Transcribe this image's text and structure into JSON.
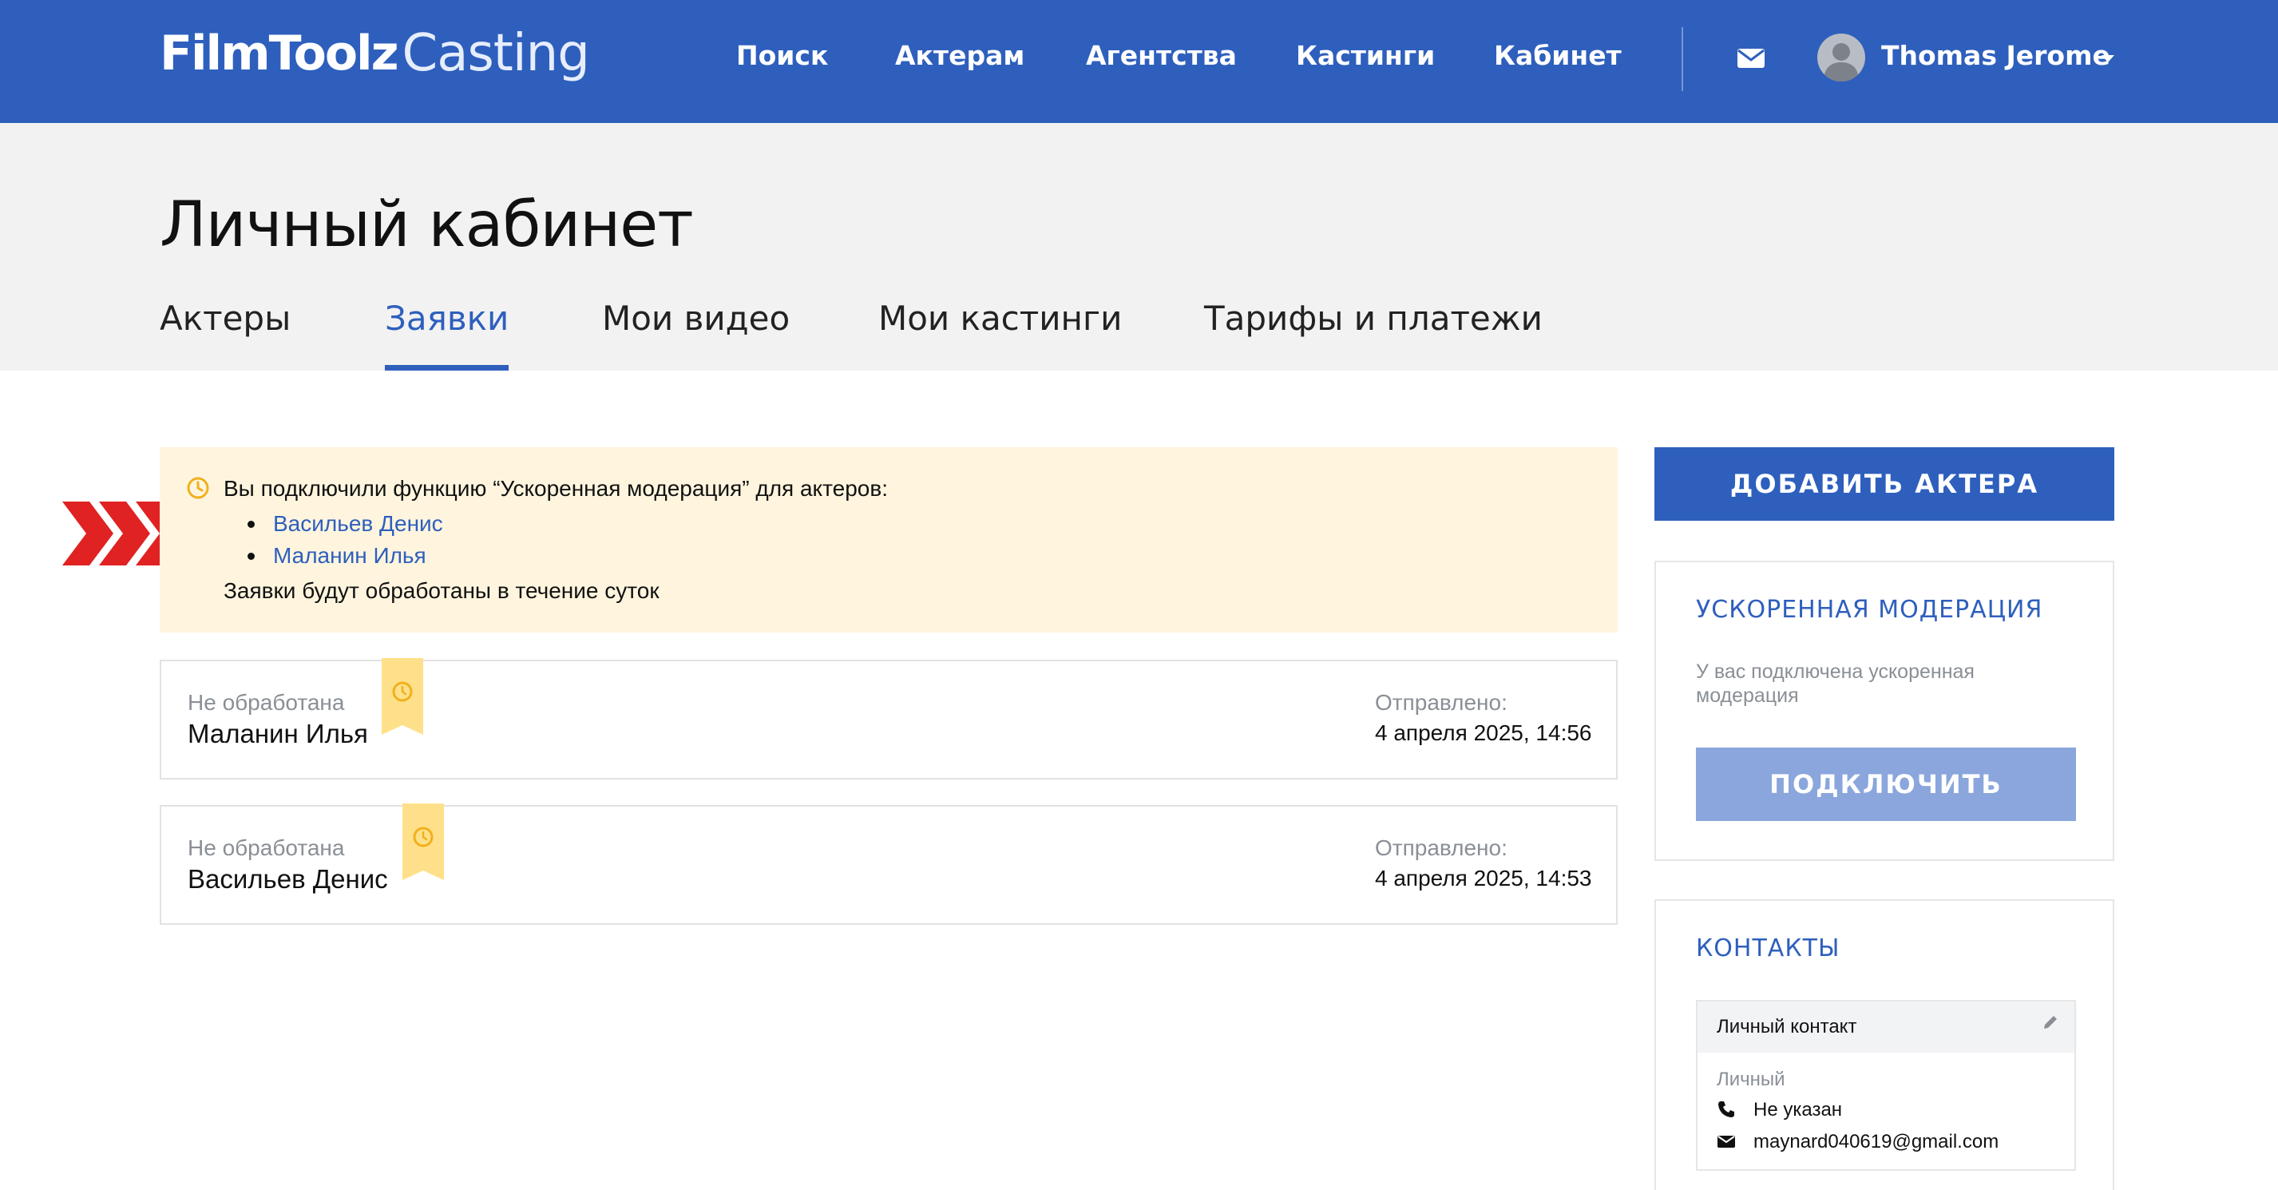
{
  "header": {
    "logo_bold": "FilmToolz",
    "logo_light": "Casting",
    "nav": [
      {
        "label": "Поиск"
      },
      {
        "label": "Актерам"
      },
      {
        "label": "Агентства"
      },
      {
        "label": "Кастинги"
      },
      {
        "label": "Кабинет"
      }
    ],
    "mail_icon": "envelope-icon",
    "user_name": "Thomas Jerome",
    "user_caret_icon": "caret-down-icon",
    "brand_color": "#2e5fbd"
  },
  "page": {
    "title": "Личный кабинет",
    "tabs": [
      {
        "label": "Актеры",
        "active": false
      },
      {
        "label": "Заявки",
        "active": true
      },
      {
        "label": "Мои видео",
        "active": false
      },
      {
        "label": "Мои кастинги",
        "active": false
      },
      {
        "label": "Тарифы и платежи",
        "active": false
      }
    ]
  },
  "notice": {
    "text": "Вы подключили функцию “Ускоренная модерация” для актеров:",
    "actors": [
      "Васильев Денис",
      "Маланин Илья"
    ],
    "footer": "Заявки будут обработаны в течение суток",
    "background": "#fff5de"
  },
  "requests": [
    {
      "status": "Не обработана",
      "name": "Маланин Илья",
      "sent_label": "Отправлено:",
      "sent_date": "4 апреля 2025, 14:56"
    },
    {
      "status": "Не обработана",
      "name": "Васильев Денис",
      "sent_label": "Отправлено:",
      "sent_date": "4 апреля 2025, 14:53"
    }
  ],
  "sidebar": {
    "add_actor_label": "ДОБАВИТЬ АКТЕРА",
    "moderation": {
      "title": "УСКОРЕННАЯ МОДЕРАЦИЯ",
      "description": "У вас подключена ускоренная модерация",
      "button_label": "ПОДКЛЮЧИТЬ"
    },
    "contacts": {
      "title": "КОНТАКТЫ",
      "card_title": "Личный контакт",
      "type": "Личный",
      "phone": "Не указан",
      "email": "maynard040619@gmail.com"
    }
  }
}
